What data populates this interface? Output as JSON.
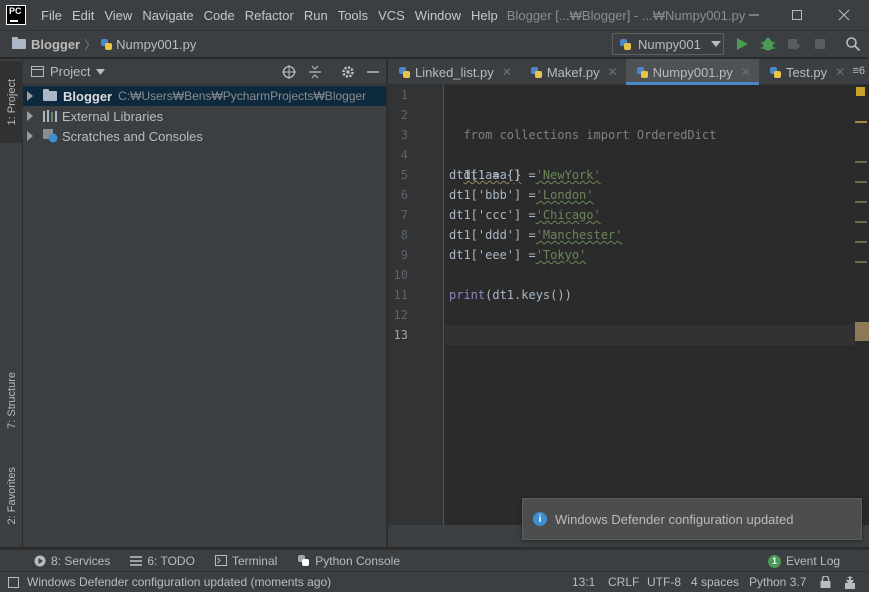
{
  "window": {
    "title": "Blogger [...₩Blogger] - ...₩Numpy001.py",
    "app_icon": "pycharm-logo",
    "app_icon_text": "PC"
  },
  "menu": [
    "File",
    "Edit",
    "View",
    "Navigate",
    "Code",
    "Refactor",
    "Run",
    "Tools",
    "VCS",
    "Window",
    "Help"
  ],
  "navbar": {
    "breadcrumb": [
      "Blogger",
      "Numpy001.py"
    ],
    "run_config": "Numpy001"
  },
  "left_stripe": {
    "project_tab": "1: Project",
    "structure_tab": "7: Structure",
    "favorites_tab": "2: Favorites"
  },
  "project_panel": {
    "title": "Project",
    "tree": [
      {
        "label": "Blogger",
        "path": "C:₩Users₩Bens₩PycharmProjects₩Blogger",
        "icon": "folder-icon"
      },
      {
        "label": "External Libraries",
        "icon": "libraries-icon"
      },
      {
        "label": "Scratches and Consoles",
        "icon": "scratches-icon"
      }
    ]
  },
  "editor": {
    "tabs": [
      {
        "label": "Linked_list.py",
        "active": false
      },
      {
        "label": "Makef.py",
        "active": false
      },
      {
        "label": "Numpy001.py",
        "active": true
      },
      {
        "label": "Test.py",
        "active": false
      }
    ],
    "tabs_overflow": "≡6",
    "line_numbers": [
      "1",
      "2",
      "3",
      "4",
      "5",
      "6",
      "7",
      "8",
      "9",
      "10",
      "11",
      "12",
      "13"
    ],
    "current_line": 13,
    "code": {
      "l2": "from collections import OrderedDict",
      "l4": "dt1 = {}",
      "l5_pre": "dt1['aaa'] =",
      "l5_str": "'NewYork'",
      "l6_pre": "dt1['bbb'] =",
      "l6_str": "'London'",
      "l7_pre": "dt1['ccc'] =",
      "l7_str": "'Chicago'",
      "l8_pre": "dt1['ddd'] =",
      "l8_str": "'Manchester'",
      "l9_pre": "dt1['eee'] =",
      "l9_str": "'Tokyo'",
      "l11_fn": "print",
      "l11_rest": "(dt1.keys())"
    }
  },
  "notification": {
    "message": "Windows Defender configuration updated"
  },
  "tool_windows": {
    "services": "8: Services",
    "todo": "6: TODO",
    "terminal": "Terminal",
    "python_console": "Python Console",
    "event_log": "Event Log",
    "event_log_count": "1"
  },
  "status": {
    "message": "Windows Defender configuration updated (moments ago)",
    "position": "13:1",
    "line_sep": "CRLF",
    "encoding": "UTF-8",
    "indent": "4 spaces",
    "interpreter": "Python 3.7"
  },
  "colors": {
    "accent": "#4a88c7",
    "string": "#6a8759",
    "run_green": "#499c54"
  }
}
